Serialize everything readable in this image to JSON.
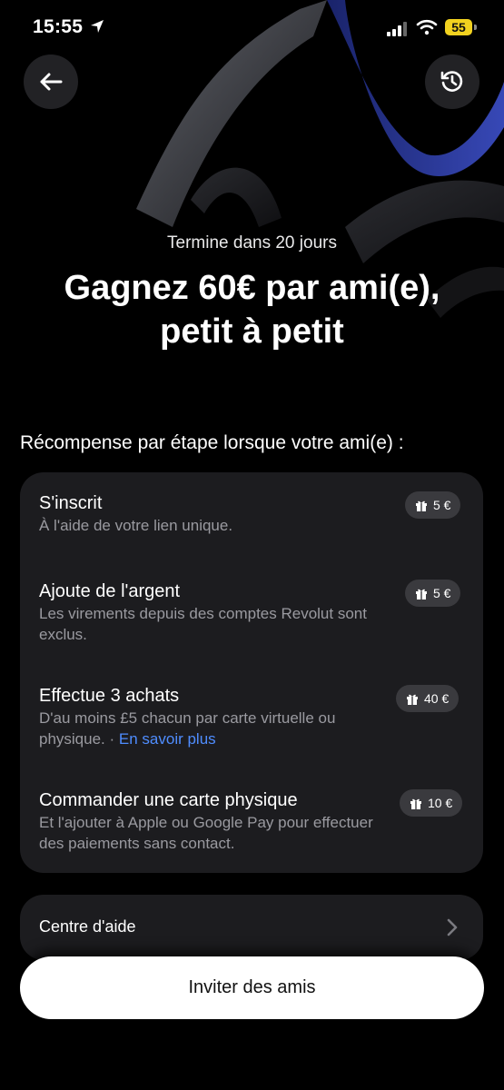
{
  "status_bar": {
    "time": "15:55",
    "battery": "55"
  },
  "header": {
    "back_icon": "arrow-left-icon",
    "history_icon": "history-clock-icon"
  },
  "hero": {
    "subtitle": "Termine dans 20 jours",
    "title_line1": "Gagnez 60€ par ami(e),",
    "title_line2": "petit à petit"
  },
  "rewards": {
    "section_label": "Récompense par étape lorsque votre ami(e) :",
    "steps": [
      {
        "title": "S'inscrit",
        "desc": "À l'aide de votre lien unique.",
        "reward": "5 €"
      },
      {
        "title": "Ajoute de l'argent",
        "desc": "Les virements depuis des comptes Revolut sont exclus.",
        "reward": "5 €"
      },
      {
        "title": "Effectue 3 achats",
        "desc": "D'au moins £5 chacun par carte virtuelle ou physique.",
        "link_sep": " · ",
        "link": "En savoir plus",
        "reward": "40 €"
      },
      {
        "title": "Commander une carte physique",
        "desc": "Et l'ajouter à Apple ou Google Pay pour effectuer des paiements sans contact.",
        "reward": "10 €"
      }
    ]
  },
  "help": {
    "label": "Centre d'aide"
  },
  "cta": {
    "label": "Inviter des amis"
  },
  "colors": {
    "background": "#000000",
    "card": "#1c1c1f",
    "link": "#4f8dff",
    "battery": "#f2d21f"
  }
}
